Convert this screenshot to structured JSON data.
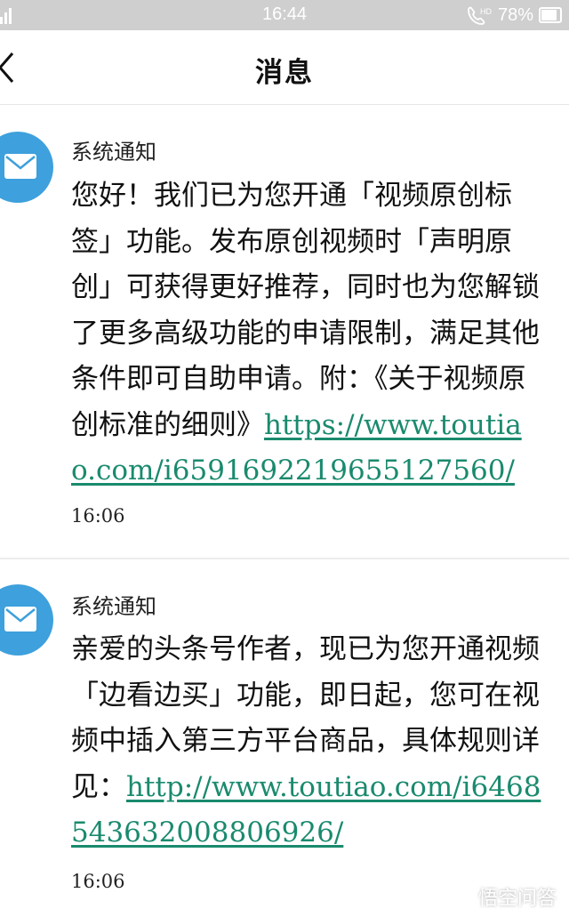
{
  "status_bar": {
    "time": "16:44",
    "network": "HD",
    "battery": "78%",
    "battery_level": 0.78
  },
  "nav": {
    "title": "消息"
  },
  "messages": [
    {
      "sender": "系统通知",
      "text": "您好！我们已为您开通「视频原创标签」功能。发布原创视频时「声明原创」可获得更好推荐，同时也为您解锁了更多高级功能的申请限制，满足其他条件即可自助申请。附：《关于视频原创标准的细则》",
      "link": "https://www.toutiao.com/i6591692219655127560/",
      "time": "16:06"
    },
    {
      "sender": "系统通知",
      "text": "亲爱的头条号作者，现已为您开通视频「边看边买」功能，即日起，您可在视频中插入第三方平台商品，具体规则详见：",
      "link": "http://www.toutiao.com/i6468543632008806926/",
      "time": "16:06"
    }
  ],
  "watermark": {
    "text": "悟空问答"
  },
  "colors": {
    "status_bar": "#cfcfcf",
    "avatar": "#3ea0dc",
    "link": "#1a8a6e",
    "divider": "#ececec"
  }
}
